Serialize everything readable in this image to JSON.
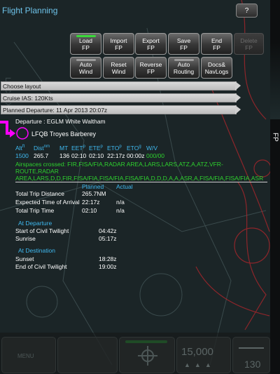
{
  "header": {
    "title": "Flight Planning",
    "help_label": "?"
  },
  "toolbar": {
    "row1": [
      {
        "line1": "Load",
        "line2": "FP",
        "indicator": "#3ad83a"
      },
      {
        "line1": "Import",
        "line2": "FP"
      },
      {
        "line1": "Export",
        "line2": "FP"
      },
      {
        "line1": "Save",
        "line2": "FP"
      },
      {
        "line1": "End",
        "line2": "FP"
      },
      {
        "line1": "Delete",
        "line2": "FP",
        "disabled": true
      }
    ],
    "row2": [
      {
        "line1": "Auto",
        "line2": "Wind",
        "indicator": "#9a9a9a"
      },
      {
        "line1": "Reset",
        "line2": "Wind"
      },
      {
        "line1": "Reverse",
        "line2": "FP"
      },
      {
        "line1": "Auto",
        "line2": "Routing",
        "indicator": "#9a9a9a"
      },
      {
        "line1": "Docs&",
        "line2": "NavLogs"
      }
    ]
  },
  "selectors": [
    "Choose layout",
    "Cruise IAS: 120Kts",
    "Planned Departure: 11 Apr 2013 20:07z"
  ],
  "route": {
    "departure": "Departure : EGLM White Waltham",
    "waypoint": "LFQB Troyes Barberey"
  },
  "leg_table": {
    "headers": [
      {
        "label": "Alt",
        "sup": "ft"
      },
      {
        "label": "Dist",
        "sup": "nm"
      },
      {
        "label": "MT",
        "sup": ""
      },
      {
        "label": "EET",
        "sup": "p"
      },
      {
        "label": "ETE",
        "sup": "p"
      },
      {
        "label": "ETO",
        "sup": "p"
      },
      {
        "label": "ETO",
        "sup": "g"
      },
      {
        "label": "W/V",
        "sup": ""
      }
    ],
    "values": [
      "1500",
      "265.7",
      "136",
      "02:10",
      "02:10",
      "22:17z",
      "00:00z",
      "000/00"
    ]
  },
  "airspaces": "Airspaces crossed: FIR,FISA/FIA,RADAR AREA,LARS,LARS,ATZ,A,ATZ,VFR-ROUTE,RADAR AREA,LARS,D,D,FIR,FISA/FIA,FISA/FIA,FISA/FIA,D,D,D,A,A,ASR,A,FISA/FIA,FISA/FIA,ASR",
  "summary": {
    "col_planned": "Planned",
    "col_actual": "Actual",
    "rows": [
      {
        "label": "Total Trip Distance",
        "planned": "265.7NM",
        "actual": ""
      },
      {
        "label": "Expected Time of Arrival",
        "planned": "22:17z",
        "actual": "n/a"
      },
      {
        "label": "Total Trip Time",
        "planned": "02:10",
        "actual": "n/a"
      }
    ]
  },
  "at_departure": {
    "heading": "At Departure",
    "rows": [
      {
        "label": "Start of Civil Twilight",
        "value": "04:42z"
      },
      {
        "label": "Sunrise",
        "value": "05:17z"
      }
    ]
  },
  "at_destination": {
    "heading": "At Destination",
    "rows": [
      {
        "label": "Sunset",
        "value": "18:28z"
      },
      {
        "label": "End of Civil Twilight",
        "value": "19:00z"
      }
    ]
  },
  "side_tab": {
    "label": "FP"
  },
  "bottom_bar": {
    "menu_label": "MENU",
    "altitude": "15,000",
    "speed": "130"
  },
  "colors": {
    "accent_blue": "#3fb9f0",
    "green": "#2ed12e",
    "route_magenta": "#ff00ff"
  }
}
